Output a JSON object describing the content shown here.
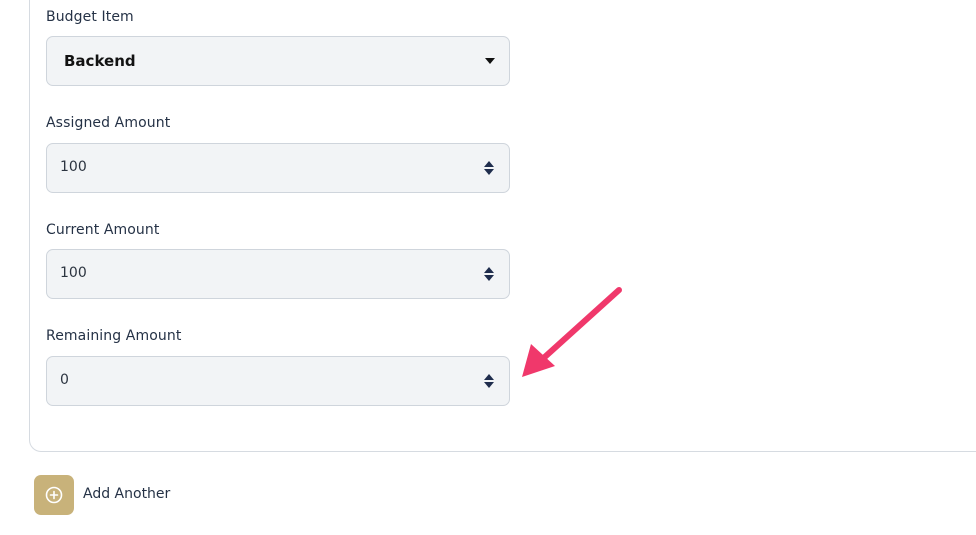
{
  "form": {
    "budget_item": {
      "label": "Budget Item",
      "value": "Backend"
    },
    "assigned_amount": {
      "label": "Assigned Amount",
      "value": "100"
    },
    "current_amount": {
      "label": "Current Amount",
      "value": "100"
    },
    "remaining_amount": {
      "label": "Remaining Amount",
      "value": "0"
    }
  },
  "actions": {
    "add_another_label": "Add Another",
    "add_icon": "plus-circle-icon"
  },
  "annotation": {
    "arrow_color": "#f0386b"
  },
  "colors": {
    "field_background": "#f2f4f6",
    "add_button": "#c8b27a"
  }
}
